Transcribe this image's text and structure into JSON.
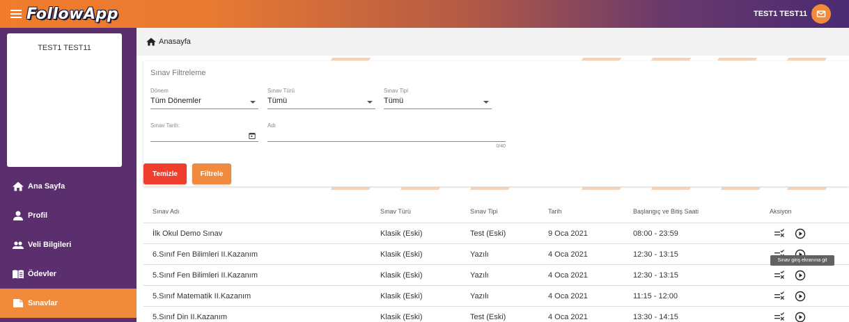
{
  "app": {
    "logo": "FollowApp"
  },
  "topbar": {
    "user_name": "TEST1 TEST11"
  },
  "sidebar": {
    "profile_name": "TEST1 TEST11",
    "items": [
      {
        "label": "Ana Sayfa",
        "icon": "home-icon"
      },
      {
        "label": "Profil",
        "icon": "person-icon"
      },
      {
        "label": "Veli Bilgileri",
        "icon": "group-icon"
      },
      {
        "label": "Ödevler",
        "icon": "book-icon"
      },
      {
        "label": "Sınavlar",
        "icon": "exam-icon",
        "active": true
      }
    ]
  },
  "breadcrumb": {
    "label": "Anasayfa"
  },
  "filter": {
    "title": "Sınav Filtreleme",
    "donem": {
      "label": "Dönem",
      "value": "Tüm Dönemler"
    },
    "sinav_turu": {
      "label": "Sınav Türü",
      "value": "Tümü"
    },
    "sinav_tipi": {
      "label": "Sınav Tipi",
      "value": "Tümü"
    },
    "sinav_tarih": {
      "label": "Sınav Tarih:",
      "value": ""
    },
    "adi": {
      "label": "Adı",
      "value": "",
      "counter": "0/40"
    },
    "clear_button": "Temizle",
    "filter_button": "Filtrele"
  },
  "table": {
    "headers": {
      "name": "Sınav Adı",
      "type": "Sınav Türü",
      "kind": "Sınav Tipi",
      "date": "Tarih",
      "time": "Başlangıç ve Bitiş Saati",
      "action": "Aksiyon"
    },
    "rows": [
      {
        "name": "İlk Okul Demo Sınav",
        "type": "Klasik (Eski)",
        "kind": "Test (Eski)",
        "date": "9 Oca 2021",
        "time": "08:00 - 23:59"
      },
      {
        "name": "6.Sınıf Fen Bilimleri II.Kazanım",
        "type": "Klasik (Eski)",
        "kind": "Yazılı",
        "date": "4 Oca 2021",
        "time": "12:30 - 13:15"
      },
      {
        "name": "5.Sınıf Fen Bilimleri II.Kazanım",
        "type": "Klasik (Eski)",
        "kind": "Yazılı",
        "date": "4 Oca 2021",
        "time": "12:30 - 13:15"
      },
      {
        "name": "5.Sınıf Matematik II.Kazanım",
        "type": "Klasik (Eski)",
        "kind": "Yazılı",
        "date": "4 Oca 2021",
        "time": "11:15 - 12:00"
      },
      {
        "name": "5.Sınıf Din II.Kazanım",
        "type": "Klasik (Eski)",
        "kind": "Test (Eski)",
        "date": "4 Oca 2021",
        "time": "13:30 - 14:15"
      }
    ]
  },
  "tooltip": {
    "text": "Sınav giriş ekranına git"
  }
}
